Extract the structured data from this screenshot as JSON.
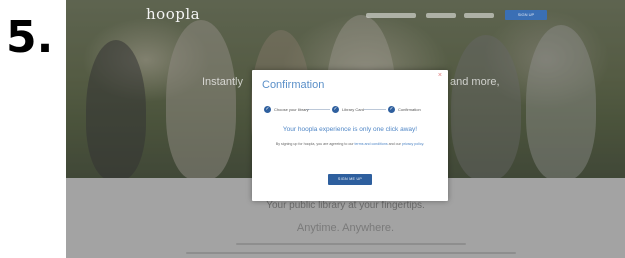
{
  "step_number": "5.",
  "site": {
    "logo": "hoopla",
    "top_signup_label": "SIGN UP",
    "hero_left": "Instantly",
    "hero_right": "and more,",
    "tagline": "Your public library at your fingertips.",
    "subline": "Anytime. Anywhere."
  },
  "modal": {
    "title": "Confirmation",
    "close_glyph": "×",
    "steps": [
      {
        "label": "Choose your library",
        "check": "✓"
      },
      {
        "label": "Library Card",
        "check": "✓"
      },
      {
        "label": "Confirmation",
        "check": "✓"
      }
    ],
    "headline": "Your hoopla experience is only one click away!",
    "body_prefix": "By signing up for hoopla, you are agreeing to our ",
    "body_link1": "terms and conditions",
    "body_mid": " and our ",
    "body_link2": "privacy policy",
    "body_suffix": ".",
    "button_label": "SIGN ME UP"
  },
  "colors": {
    "accent_blue": "#2e5f9e",
    "link_blue": "#4f86c6",
    "close_red": "#e07a7a"
  }
}
